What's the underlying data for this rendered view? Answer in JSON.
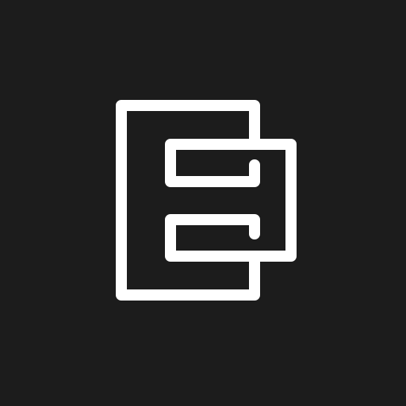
{
  "icon": {
    "name": "logo-icon",
    "background_color": "#1c1c1c",
    "stroke_color": "#ffffff"
  }
}
